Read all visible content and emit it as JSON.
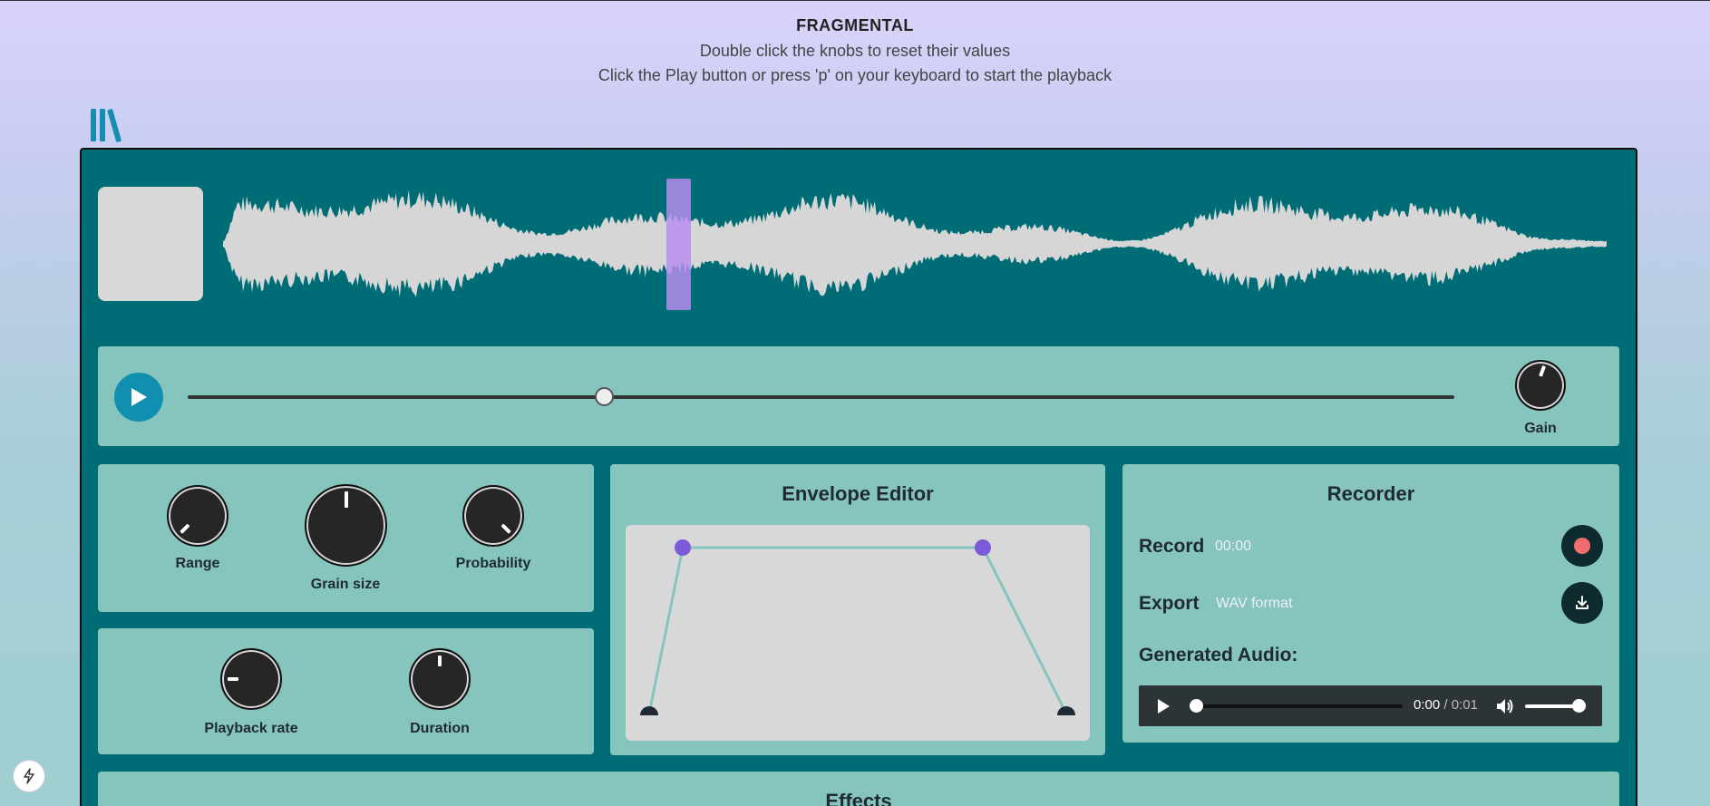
{
  "header": {
    "title": "FRAGMENTAL",
    "line1": "Double click the knobs to reset their values",
    "line2": "Click the Play button or press 'p' on your keyboard to start the playback"
  },
  "icons": {
    "logo": "library-icon",
    "play": "play-icon",
    "record": "record-icon",
    "download": "download-icon",
    "volume": "volume-icon",
    "bolt": "bolt-icon"
  },
  "transport": {
    "position": 0.33,
    "gain_label": "Gain"
  },
  "grain_knobs": {
    "range_label": "Range",
    "grain_size_label": "Grain size",
    "probability_label": "Probability"
  },
  "playback_knobs": {
    "playback_rate_label": "Playback rate",
    "duration_label": "Duration"
  },
  "envelope": {
    "title": "Envelope Editor"
  },
  "recorder": {
    "title": "Recorder",
    "record_label": "Record",
    "record_time": "00:00",
    "export_label": "Export",
    "export_format": "WAV format",
    "generated_label": "Generated Audio:",
    "player_current": "0:00",
    "player_sep": " / ",
    "player_total": "0:01"
  },
  "effects": {
    "title": "Effects"
  },
  "colors": {
    "app_bg": "#006d76",
    "panel": "#86c5be",
    "accent_play": "#118fb0",
    "envelope_point": "#7a5ad8",
    "record_dot": "#f26d6d"
  }
}
